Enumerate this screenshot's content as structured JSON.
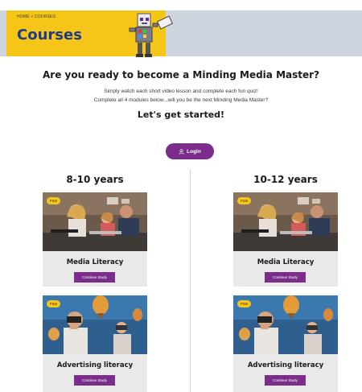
{
  "header": {
    "breadcrumb": "HOME » COURSES",
    "title": "Courses"
  },
  "intro": {
    "headline": "Are you ready to become a Minding Media Master?",
    "line1": "Simply watch each short video lesson and complete each fun quiz!",
    "line2": "Complete all 4 modules below...will you be the next Minding Media Master?",
    "cta": "Let's get started!"
  },
  "login": {
    "label": "Login",
    "icon": "user-icon"
  },
  "columns": [
    {
      "title": "8-10 years",
      "cards": [
        {
          "badge": "Free",
          "title": "Media Literacy",
          "button": "Continue Study"
        },
        {
          "badge": "Free",
          "title": "Advertising literacy",
          "button": "Continue Study"
        }
      ]
    },
    {
      "title": "10-12 years",
      "cards": [
        {
          "badge": "Free",
          "title": "Media Literacy",
          "button": "Continue Study"
        },
        {
          "badge": "Free",
          "title": "Advertising literacy",
          "button": "Continue Study"
        }
      ]
    }
  ],
  "colors": {
    "banner_yellow": "#f5c518",
    "banner_gray": "#cfd5de",
    "title_blue": "#1f3b88",
    "accent_purple": "#7b2d8c"
  }
}
